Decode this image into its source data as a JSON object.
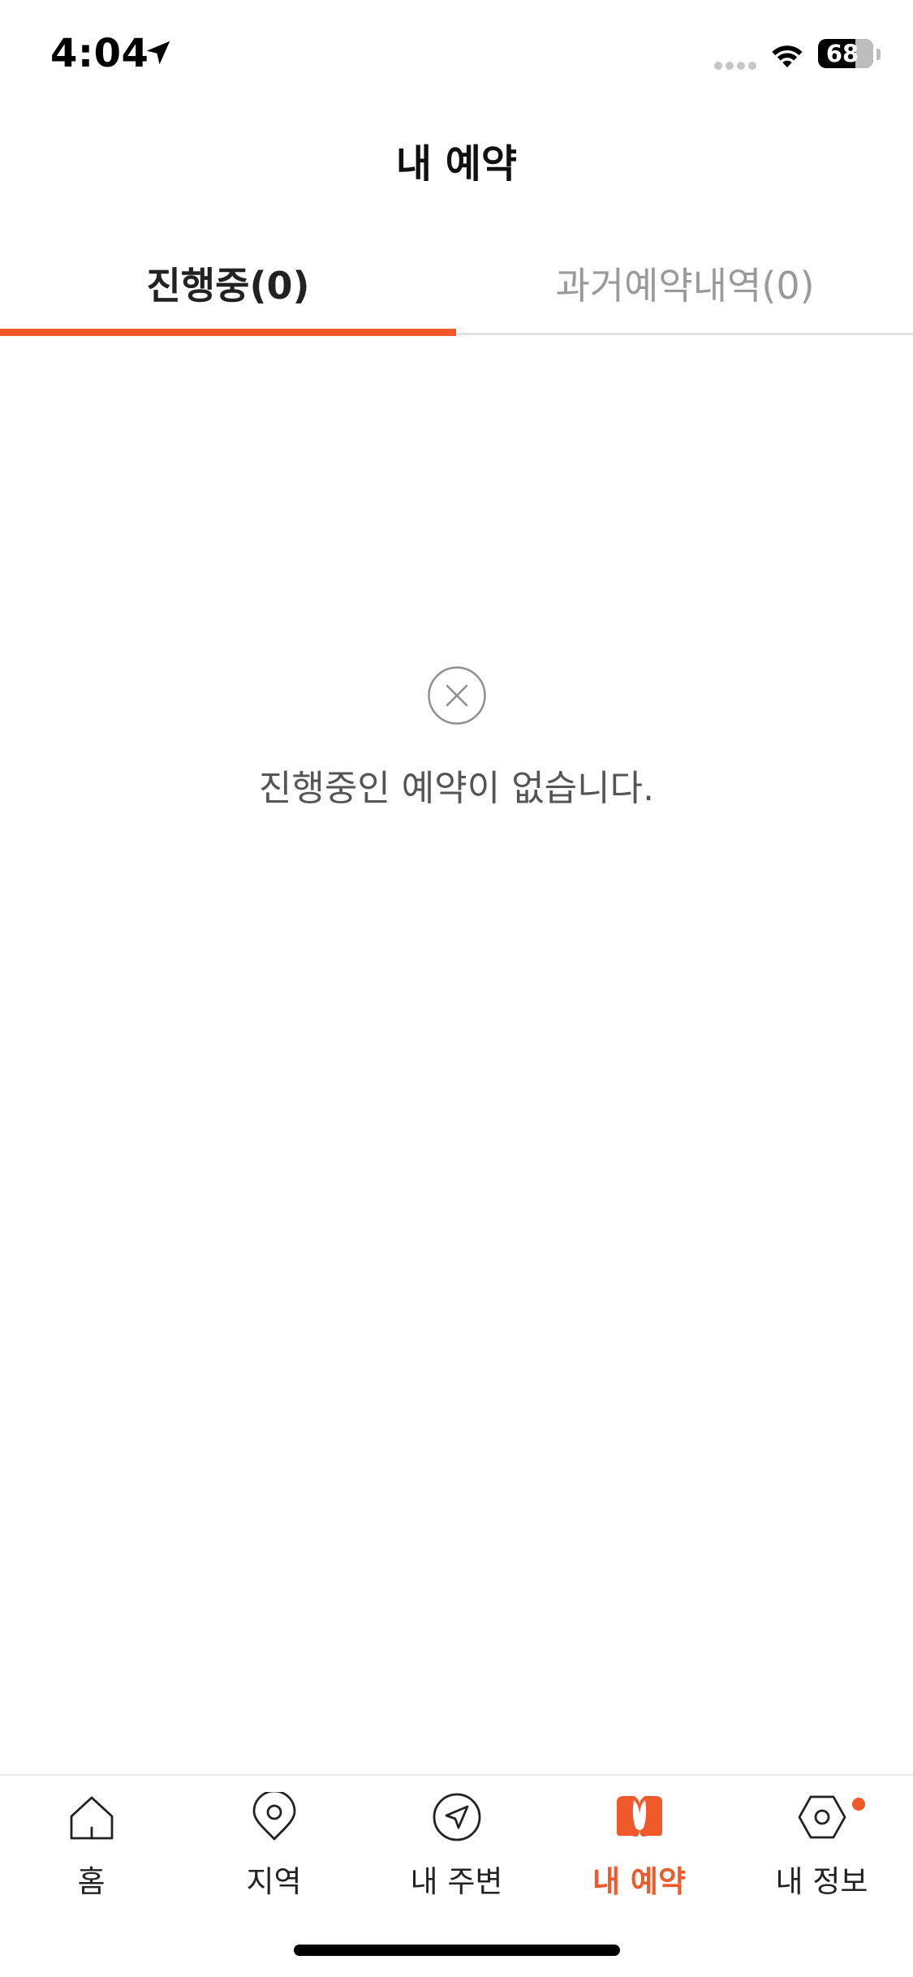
{
  "status_bar": {
    "time": "4:04",
    "battery_percent": "68",
    "battery_level": 0.68
  },
  "header": {
    "title": "내 예약"
  },
  "tabs": [
    {
      "label": "진행중(0)",
      "active": true
    },
    {
      "label": "과거예약내역(0)",
      "active": false
    }
  ],
  "empty_state": {
    "icon": "x-circle-icon",
    "message": "진행중인 예약이 없습니다."
  },
  "bottom_nav": {
    "items": [
      {
        "label": "홈",
        "icon": "home-icon",
        "active": false
      },
      {
        "label": "지역",
        "icon": "location-pin-icon",
        "active": false
      },
      {
        "label": "내 주변",
        "icon": "navigation-arrow-icon",
        "active": false
      },
      {
        "label": "내 예약",
        "icon": "reservation-icon",
        "active": true
      },
      {
        "label": "내 정보",
        "icon": "hexagon-profile-icon",
        "active": false,
        "has_badge": true
      }
    ]
  },
  "colors": {
    "accent": "#f05a2a",
    "inactive_text": "#9a9a9a",
    "body_text": "#555555"
  }
}
